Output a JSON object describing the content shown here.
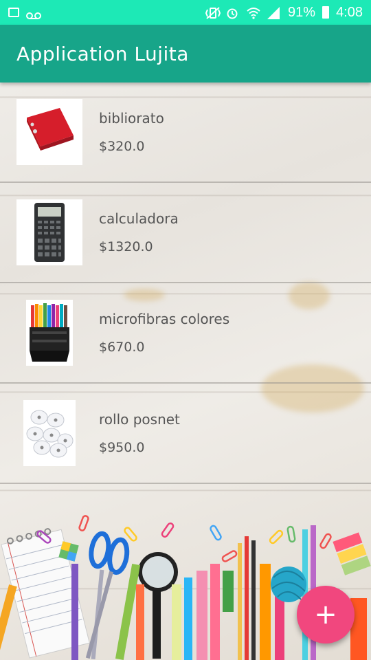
{
  "status_bar": {
    "battery": "91%",
    "time": "4:08",
    "icons": [
      "image-icon",
      "voicemail-icon",
      "vibrate-icon",
      "alarm-icon",
      "wifi-icon",
      "signal-icon",
      "battery-icon"
    ]
  },
  "app_bar": {
    "title": "Application Lujita"
  },
  "products": [
    {
      "name": "bibliorato",
      "price": "$320.0",
      "image": "binder-image"
    },
    {
      "name": "calculadora",
      "price": "$1320.0",
      "image": "calculator-image"
    },
    {
      "name": "microfibras colores",
      "price": "$670.0",
      "image": "markers-image"
    },
    {
      "name": "rollo posnet",
      "price": "$950.0",
      "image": "paper-rolls-image"
    }
  ],
  "fab": {
    "label": "+",
    "color": "#f1477e"
  },
  "colors": {
    "status_bar": "#1de9b6",
    "app_bar": "#17a589",
    "fab": "#f1477e"
  }
}
